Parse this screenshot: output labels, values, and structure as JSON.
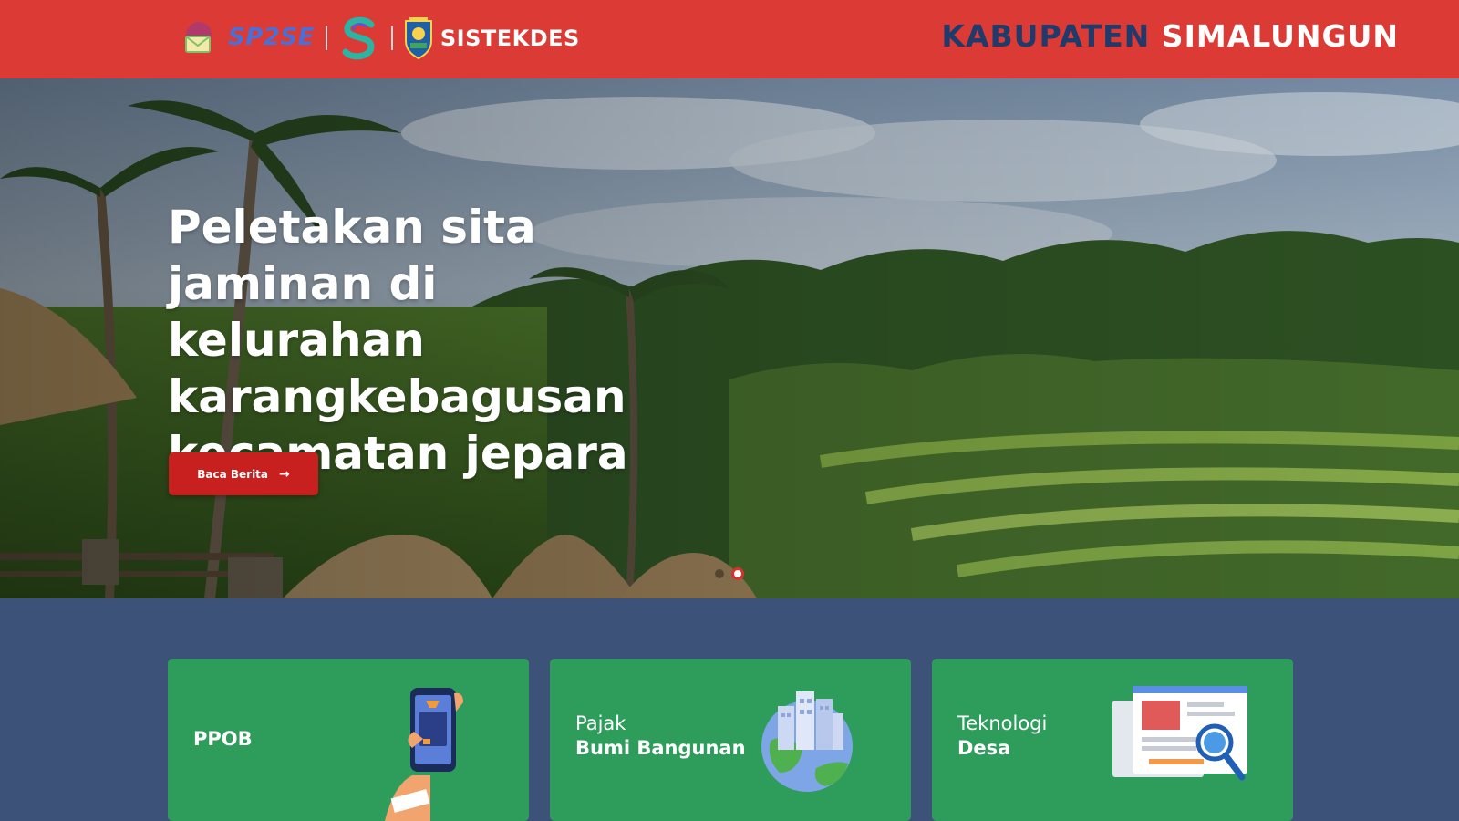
{
  "header": {
    "logo_sp2se": "SP2SE",
    "logo_sistekdes": "SISTEKDES",
    "region_prefix": "KABUPATEN",
    "region_name": "SIMALUNGUN",
    "colors": {
      "bar": "#dc3a35",
      "prefix": "#1f3b6c",
      "name": "#ffffff"
    }
  },
  "hero": {
    "headline_lines": [
      "Peletakan sita",
      "jaminan di kelurahan",
      "karangkebagusan",
      "kecamatan jepara"
    ],
    "cta_label": "Baca Berita",
    "cta_icon": "arrow-right-icon",
    "slides": {
      "count": 2,
      "active": 2
    }
  },
  "services": [
    {
      "line1": "PPOB",
      "line2": "",
      "icon": "phone-payment-icon"
    },
    {
      "line1": "Pajak",
      "line2": "Bumi Bangunan",
      "icon": "globe-city-icon"
    },
    {
      "line1": "Teknologi",
      "line2": "Desa",
      "icon": "web-search-icon"
    }
  ],
  "colors": {
    "cta": "#c8201f",
    "card": "#2e9d5b",
    "section_bg": "#3d5278"
  }
}
